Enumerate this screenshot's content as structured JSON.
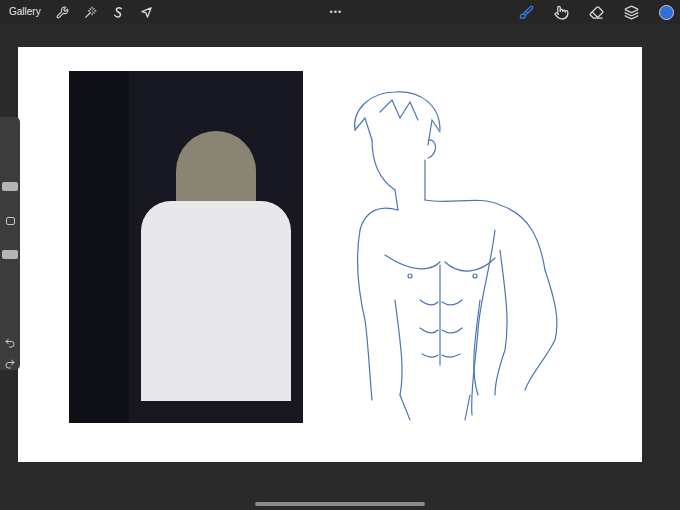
{
  "toolbar": {
    "gallery": "Gallery",
    "menu": "•••",
    "tools": [
      {
        "selected": true
      },
      {
        "selected": false
      },
      {
        "selected": false
      },
      {
        "selected": false
      }
    ],
    "current_color": "#2f6fd6"
  },
  "sidebar": {
    "brush_size": {
      "level": 0.25
    },
    "opacity": {
      "level": 0.82
    }
  }
}
